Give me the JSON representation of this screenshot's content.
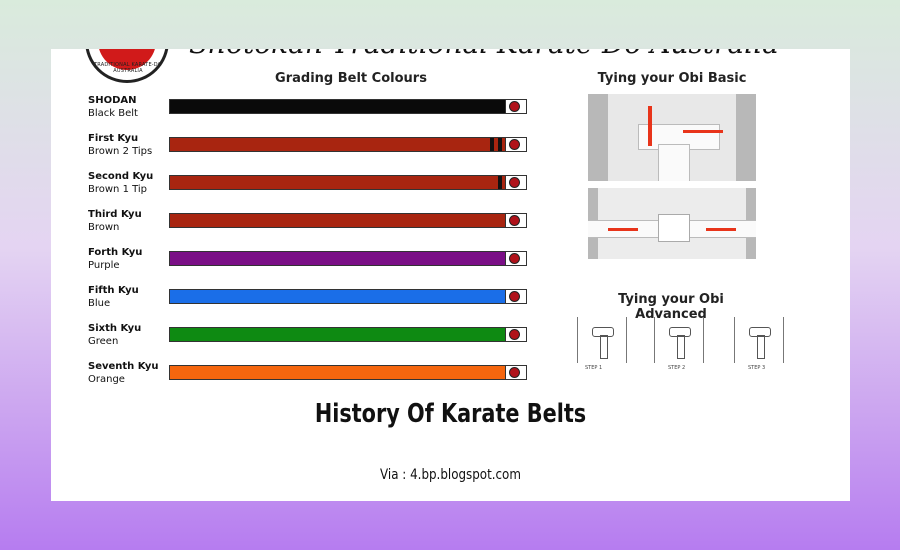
{
  "poster": {
    "org_title": "Shotokan Traditional Karate-Do Australia",
    "logo_text": "TRADITIONAL KARATE-DO AUSTRALIA",
    "grading_title": "Grading Belt Colours",
    "obi_basic_title": "Tying your Obi Basic",
    "obi_advanced_title": "Tying your Obi Advanced",
    "steps": [
      "STEP 1",
      "STEP 2",
      "STEP 3"
    ],
    "belts": [
      {
        "rank": "SHODAN",
        "name": "Black Belt",
        "color": "#0a0a0a",
        "tips": 0
      },
      {
        "rank": "First Kyu",
        "name": "Brown 2 Tips",
        "color": "#a82510",
        "tips": 2
      },
      {
        "rank": "Second Kyu",
        "name": "Brown 1 Tip",
        "color": "#a82510",
        "tips": 1
      },
      {
        "rank": "Third Kyu",
        "name": "Brown",
        "color": "#a82510",
        "tips": 0
      },
      {
        "rank": "Forth Kyu",
        "name": "Purple",
        "color": "#7a0f86",
        "tips": 0
      },
      {
        "rank": "Fifth Kyu",
        "name": "Blue",
        "color": "#1a6ee8",
        "tips": 0
      },
      {
        "rank": "Sixth Kyu",
        "name": "Green",
        "color": "#0e8a12",
        "tips": 0
      },
      {
        "rank": "Seventh Kyu",
        "name": "Orange",
        "color": "#f5660e",
        "tips": 0
      }
    ]
  },
  "caption": {
    "headline": "History Of Karate Belts",
    "via": "Via : 4.bp.blogspot.com"
  }
}
